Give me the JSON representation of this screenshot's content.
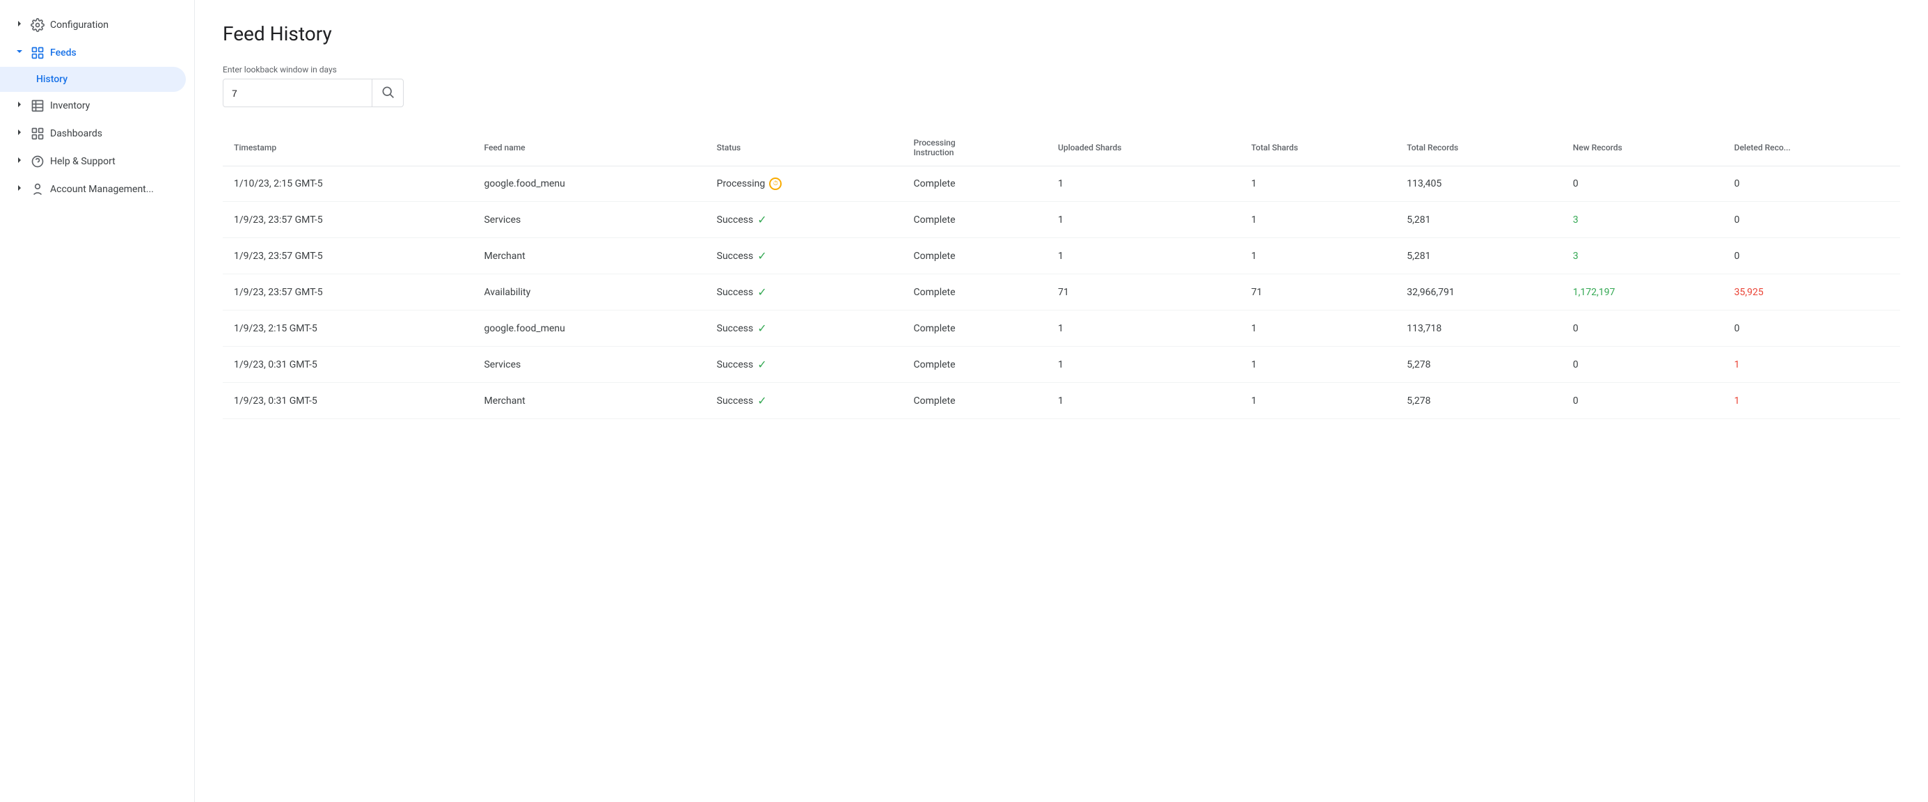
{
  "sidebar": {
    "items": [
      {
        "id": "configuration",
        "label": "Configuration",
        "icon": "gear",
        "expanded": false,
        "active": false
      },
      {
        "id": "feeds",
        "label": "Feeds",
        "icon": "grid",
        "expanded": true,
        "active": false
      },
      {
        "id": "inventory",
        "label": "Inventory",
        "icon": "table",
        "expanded": false,
        "active": false
      },
      {
        "id": "dashboards",
        "label": "Dashboards",
        "icon": "dashboard",
        "expanded": false,
        "active": false
      },
      {
        "id": "help",
        "label": "Help & Support",
        "icon": "help",
        "expanded": false,
        "active": false
      },
      {
        "id": "account",
        "label": "Account Management...",
        "icon": "account",
        "expanded": false,
        "active": false
      }
    ],
    "feeds_child": "History"
  },
  "page": {
    "title": "Feed History",
    "search_label": "Enter lookback window in days",
    "search_value": "7",
    "search_placeholder": "7"
  },
  "table": {
    "columns": [
      "Timestamp",
      "Feed name",
      "Status",
      "Processing Instruction",
      "Uploaded Shards",
      "Total Shards",
      "Total Records",
      "New Records",
      "Deleted Records"
    ],
    "rows": [
      {
        "timestamp": "1/10/23, 2:15 GMT-5",
        "feed_name": "google.food_menu",
        "status": "Processing",
        "status_type": "processing",
        "processing_instruction": "Complete",
        "uploaded_shards": "1",
        "total_shards": "1",
        "total_records": "113,405",
        "new_records": "0",
        "new_records_type": "default",
        "deleted_records": "0",
        "deleted_records_type": "default"
      },
      {
        "timestamp": "1/9/23, 23:57 GMT-5",
        "feed_name": "Services",
        "status": "Success",
        "status_type": "success",
        "processing_instruction": "Complete",
        "uploaded_shards": "1",
        "total_shards": "1",
        "total_records": "5,281",
        "new_records": "3",
        "new_records_type": "green",
        "deleted_records": "0",
        "deleted_records_type": "default"
      },
      {
        "timestamp": "1/9/23, 23:57 GMT-5",
        "feed_name": "Merchant",
        "status": "Success",
        "status_type": "success",
        "processing_instruction": "Complete",
        "uploaded_shards": "1",
        "total_shards": "1",
        "total_records": "5,281",
        "new_records": "3",
        "new_records_type": "green",
        "deleted_records": "0",
        "deleted_records_type": "default"
      },
      {
        "timestamp": "1/9/23, 23:57 GMT-5",
        "feed_name": "Availability",
        "status": "Success",
        "status_type": "success",
        "processing_instruction": "Complete",
        "uploaded_shards": "71",
        "total_shards": "71",
        "total_records": "32,966,791",
        "new_records": "1,172,197",
        "new_records_type": "green",
        "deleted_records": "35,925",
        "deleted_records_type": "red"
      },
      {
        "timestamp": "1/9/23, 2:15 GMT-5",
        "feed_name": "google.food_menu",
        "status": "Success",
        "status_type": "success",
        "processing_instruction": "Complete",
        "uploaded_shards": "1",
        "total_shards": "1",
        "total_records": "113,718",
        "new_records": "0",
        "new_records_type": "default",
        "deleted_records": "0",
        "deleted_records_type": "default"
      },
      {
        "timestamp": "1/9/23, 0:31 GMT-5",
        "feed_name": "Services",
        "status": "Success",
        "status_type": "success",
        "processing_instruction": "Complete",
        "uploaded_shards": "1",
        "total_shards": "1",
        "total_records": "5,278",
        "new_records": "0",
        "new_records_type": "default",
        "deleted_records": "1",
        "deleted_records_type": "red"
      },
      {
        "timestamp": "1/9/23, 0:31 GMT-5",
        "feed_name": "Merchant",
        "status": "Success",
        "status_type": "success",
        "processing_instruction": "Complete",
        "uploaded_shards": "1",
        "total_shards": "1",
        "total_records": "5,278",
        "new_records": "0",
        "new_records_type": "default",
        "deleted_records": "1",
        "deleted_records_type": "red"
      }
    ]
  }
}
